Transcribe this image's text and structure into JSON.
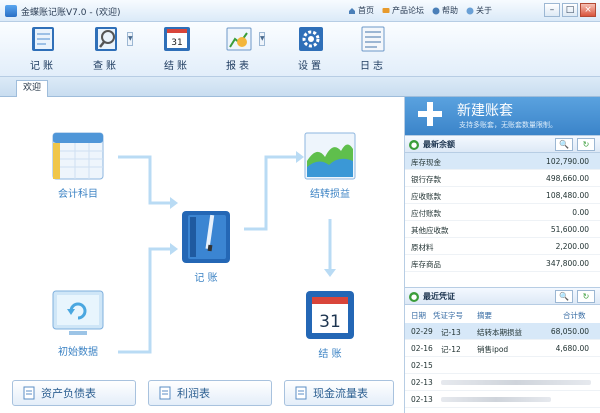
{
  "window": {
    "title": "金蝶账记账V7.0 - (欢迎)",
    "nav": [
      "首页",
      "产品论坛",
      "帮助",
      "关于"
    ],
    "controls": [
      "–",
      "□",
      "×"
    ]
  },
  "toolbar": {
    "items": [
      {
        "label": "记账",
        "icon": "ledger-book-icon"
      },
      {
        "label": "查账",
        "icon": "magnifier-book-icon"
      },
      {
        "label": "结账",
        "icon": "calendar-icon"
      },
      {
        "label": "报表",
        "icon": "chart-report-icon"
      },
      {
        "label": "设置",
        "icon": "gear-icon"
      },
      {
        "label": "日志",
        "icon": "log-list-icon"
      }
    ]
  },
  "tabs": [
    {
      "label": "欢迎"
    }
  ],
  "flow": {
    "nodes": {
      "accounts": "会计科目",
      "journal": "记 账",
      "transfer": "结转损益",
      "initial": "初始数据",
      "close": "结 账"
    },
    "bottom_buttons": [
      "资产负债表",
      "利润表",
      "现金流量表"
    ]
  },
  "right_panel": {
    "new_set": {
      "title": "新建账套",
      "subtitle": "支持多账套，无账套数量限制。"
    },
    "balance": {
      "title": "最新余额",
      "rows": [
        {
          "name": "库存现金",
          "value": "102,790.00"
        },
        {
          "name": "银行存款",
          "value": "498,660.00"
        },
        {
          "name": "应收账款",
          "value": "108,480.00"
        },
        {
          "name": "应付账款",
          "value": "0.00"
        },
        {
          "name": "其他应收款",
          "value": "51,600.00"
        },
        {
          "name": "原材料",
          "value": "2,200.00"
        },
        {
          "name": "库存商品",
          "value": "347,800.00"
        }
      ]
    },
    "vouchers": {
      "title": "最近凭证",
      "headers": [
        "日期",
        "凭证字号",
        "摘要",
        "合计数"
      ],
      "rows": [
        {
          "date": "02-29",
          "no": "记-13",
          "summary": "结转本期损益",
          "amount": "68,050.00"
        },
        {
          "date": "02-16",
          "no": "记-12",
          "summary": "销售ipod",
          "amount": "4,680.00"
        },
        {
          "date": "02-15",
          "no": "",
          "summary": "",
          "amount": ""
        },
        {
          "date": "02-13",
          "no": "",
          "summary": "",
          "amount": ""
        },
        {
          "date": "02-13",
          "no": "",
          "summary": "",
          "amount": ""
        }
      ]
    }
  },
  "colors": {
    "accent": "#3b84c9",
    "flow_arrow": "#b9dbf4",
    "link_text": "#3c83c4"
  }
}
